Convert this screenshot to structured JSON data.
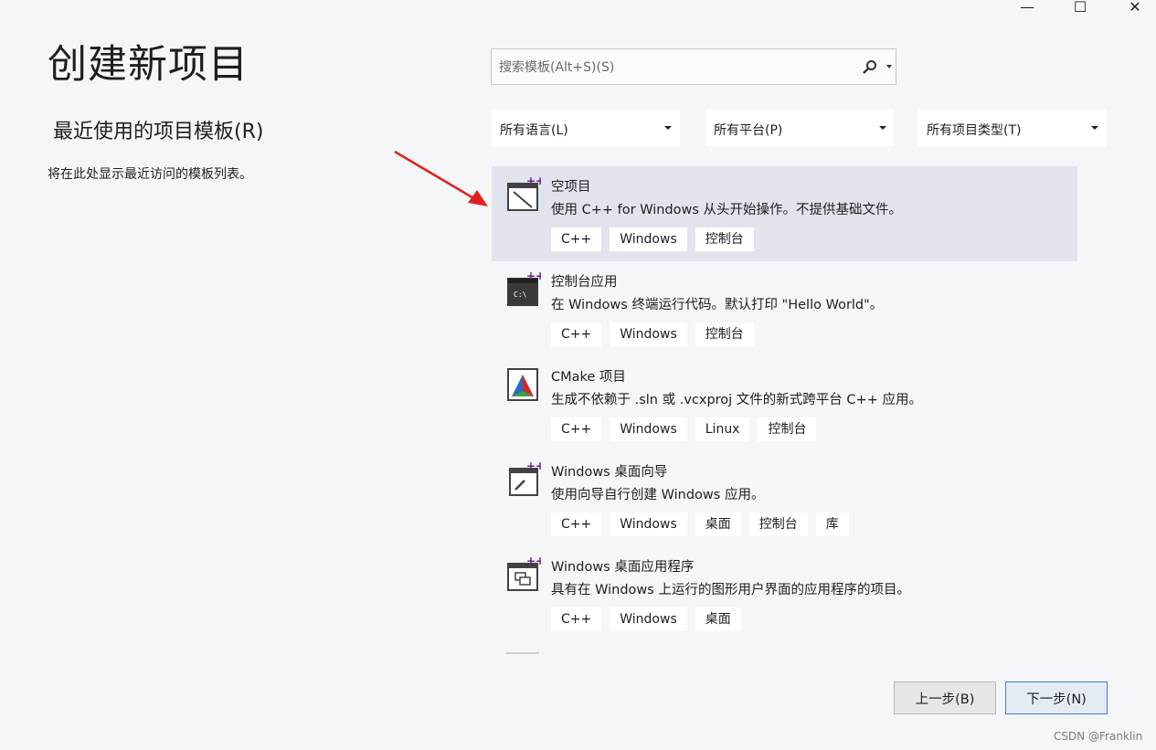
{
  "window": {
    "minimize": "—",
    "maximize": "☐",
    "close": "✕"
  },
  "title": "创建新项目",
  "recent": {
    "title": "最近使用的项目模板(R)",
    "desc": "将在此处显示最近访问的模板列表。"
  },
  "search": {
    "placeholder": "搜索模板(Alt+S)(S)"
  },
  "filters": {
    "language": "所有语言(L)",
    "platform": "所有平台(P)",
    "type": "所有项目类型(T)"
  },
  "templates": [
    {
      "name": "空项目",
      "desc": "使用 C++ for Windows 从头开始操作。不提供基础文件。",
      "tags": [
        "C++",
        "Windows",
        "控制台"
      ],
      "selected": true,
      "icon": "empty-project-icon"
    },
    {
      "name": "控制台应用",
      "desc": "在 Windows 终端运行代码。默认打印 \"Hello World\"。",
      "tags": [
        "C++",
        "Windows",
        "控制台"
      ],
      "selected": false,
      "icon": "console-app-icon"
    },
    {
      "name": "CMake 项目",
      "desc": "生成不依赖于 .sln 或 .vcxproj 文件的新式跨平台 C++ 应用。",
      "tags": [
        "C++",
        "Windows",
        "Linux",
        "控制台"
      ],
      "selected": false,
      "icon": "cmake-icon"
    },
    {
      "name": "Windows 桌面向导",
      "desc": "使用向导自行创建 Windows 应用。",
      "tags": [
        "C++",
        "Windows",
        "桌面",
        "控制台",
        "库"
      ],
      "selected": false,
      "icon": "desktop-wizard-icon"
    },
    {
      "name": "Windows 桌面应用程序",
      "desc": "具有在 Windows 上运行的图形用户界面的应用程序的项目。",
      "tags": [
        "C++",
        "Windows",
        "桌面"
      ],
      "selected": false,
      "icon": "desktop-app-icon"
    }
  ],
  "buttons": {
    "back": "上一步(B)",
    "next": "下一步(N)"
  },
  "watermark": "CSDN @Franklin",
  "colors": {
    "selected_bg": "#e1e4ec",
    "accent": "#3e7bd6",
    "arrow": "#e02020",
    "cpp_purple": "#68217a"
  }
}
